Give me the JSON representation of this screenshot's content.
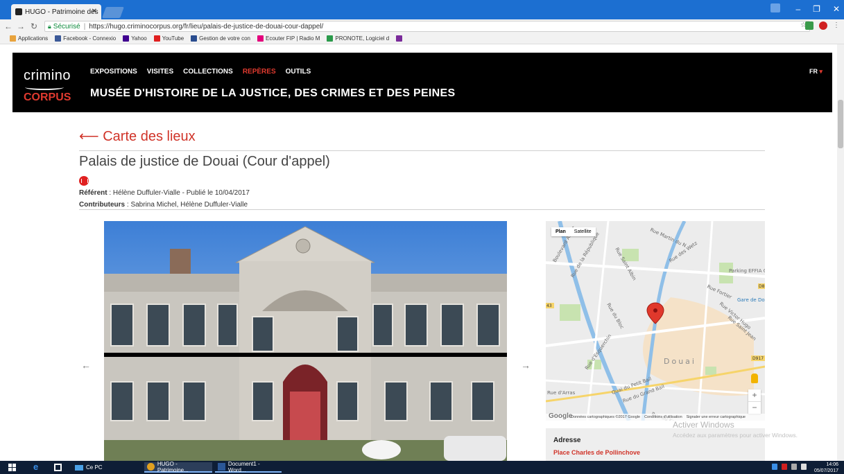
{
  "browser": {
    "tab_title": "HUGO - Patrimoine des",
    "secure_label": "Sécurisé",
    "url": "https://hugo.criminocorpus.org/fr/lieu/palais-de-justice-de-douai-cour-dappel/",
    "bookmarks": [
      {
        "label": "Applications",
        "color": "#e8a33d"
      },
      {
        "label": "Facebook - Connexio",
        "color": "#3b5998"
      },
      {
        "label": "Yahoo",
        "color": "#400090"
      },
      {
        "label": "YouTube",
        "color": "#e02020"
      },
      {
        "label": "Gestion de votre con",
        "color": "#2a4d8f"
      },
      {
        "label": "Ecouter FIP | Radio M",
        "color": "#e4007c"
      },
      {
        "label": "PRONOTE, Logiciel d",
        "color": "#2a9a4a"
      },
      {
        "label": "",
        "color": "#7a2a9a"
      }
    ]
  },
  "site": {
    "logo_top": "crimino",
    "logo_bottom": "CORPUS",
    "nav": [
      {
        "label": "EXPOSITIONS",
        "active": false
      },
      {
        "label": "VISITES",
        "active": false
      },
      {
        "label": "COLLECTIONS",
        "active": false
      },
      {
        "label": "REPÈRES",
        "active": true
      },
      {
        "label": "OUTILS",
        "active": false
      }
    ],
    "museum_title": "MUSÉE D'HISTOIRE DE LA JUSTICE, DES CRIMES ET DES PEINES",
    "lang": "FR"
  },
  "page": {
    "back_arrow": "⟵",
    "back_label": "Carte des lieux",
    "title": "Palais de justice de Douai (Cour d'appel)",
    "referent_label": "Référent",
    "referent_value": "Hélène Duffuler-Vialle - Publié le 10/04/2017",
    "contributors_label": "Contributeurs",
    "contributors_value": "Sabrina Michel, Hélène Duffuler-Vialle",
    "prev_arrow": "←",
    "next_arrow": "→"
  },
  "map": {
    "toggle_plan": "Plan",
    "toggle_satellite": "Satellite",
    "city_label": "Douai",
    "streets": [
      "Rue Martin du N",
      "Rue Saint Albin",
      "Rue des Wetz",
      "Rue Fortier",
      "Rue Victor Hugo",
      "Rue Saint Jean",
      "Rue du Bloc",
      "Rue de la République",
      "Boulevard Albert",
      "Rue d'Esquerchin",
      "Quai du Petit Bail",
      "Rue du Grand Bail",
      "Rue du Kron",
      "Rue d'Arras"
    ],
    "pois": [
      "Parking EFFIA Gare de Douai",
      "Gare de Do"
    ],
    "road_badges": [
      "D917",
      "D8",
      "43"
    ],
    "zoom_in": "+",
    "zoom_out": "−",
    "google": "Google",
    "footer": [
      "Données cartographiques ©2017 Google",
      "Conditions d'utilisation",
      "Signaler une erreur cartographique"
    ]
  },
  "address": {
    "label": "Adresse",
    "value": "Place Charles de Pollinchove"
  },
  "watermark": {
    "line1": "Activer Windows",
    "line2": "Accédez aux paramètres pour activer Windows."
  },
  "taskbar": {
    "items": [
      "Ce PC",
      "HUGO - Patrimoine...",
      "Document1 - Word..."
    ],
    "time": "14:06",
    "date": "05/07/2017"
  },
  "colors": {
    "accent_red": "#d03328",
    "chrome_blue": "#1c6fd1",
    "header_black": "#000000",
    "taskbar": "#0e1e36"
  }
}
